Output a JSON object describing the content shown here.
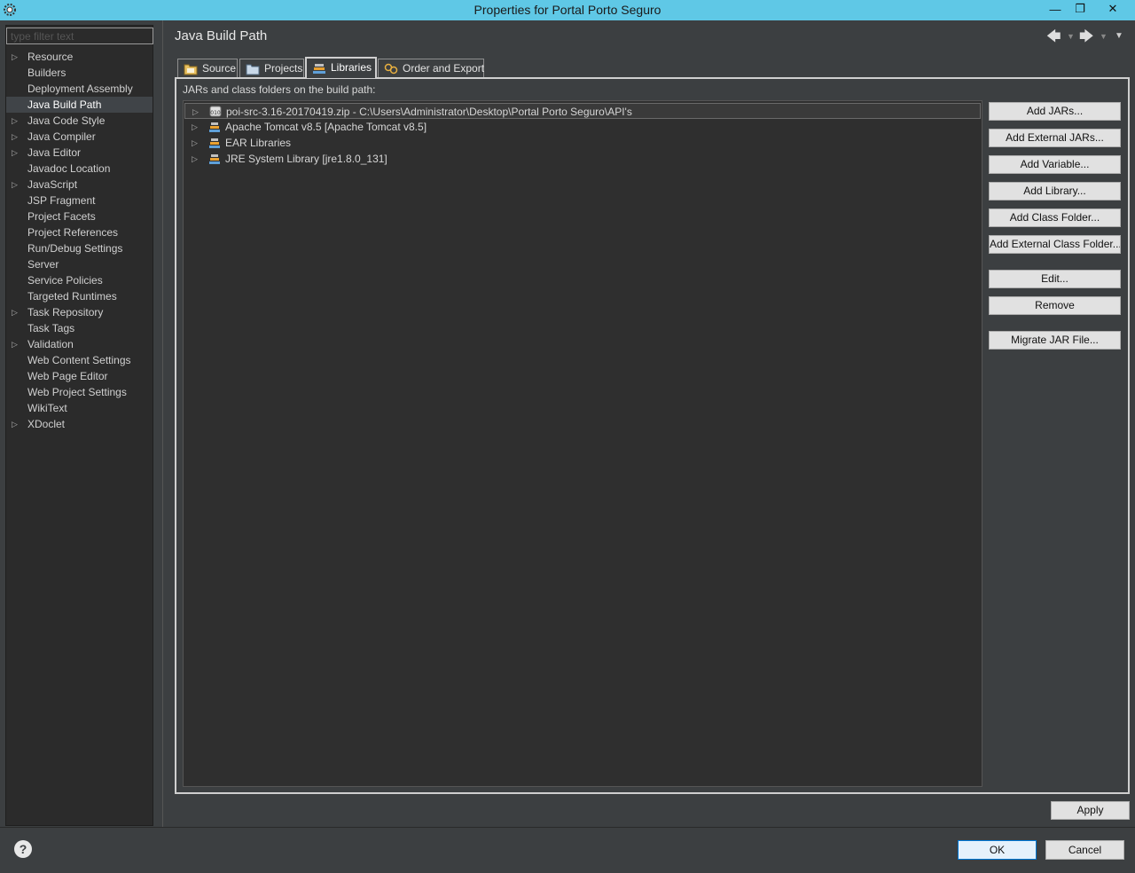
{
  "window": {
    "title": "Properties for Portal Porto Seguro",
    "minimize_glyph": "—",
    "maximize_glyph": "❐",
    "close_glyph": "✕"
  },
  "filter": {
    "placeholder": "type filter text"
  },
  "nav_tree": {
    "items": [
      {
        "label": "Resource",
        "expandable": true
      },
      {
        "label": "Builders",
        "expandable": false
      },
      {
        "label": "Deployment Assembly",
        "expandable": false
      },
      {
        "label": "Java Build Path",
        "expandable": false,
        "selected": true
      },
      {
        "label": "Java Code Style",
        "expandable": true
      },
      {
        "label": "Java Compiler",
        "expandable": true
      },
      {
        "label": "Java Editor",
        "expandable": true
      },
      {
        "label": "Javadoc Location",
        "expandable": false
      },
      {
        "label": "JavaScript",
        "expandable": true
      },
      {
        "label": "JSP Fragment",
        "expandable": false
      },
      {
        "label": "Project Facets",
        "expandable": false
      },
      {
        "label": "Project References",
        "expandable": false
      },
      {
        "label": "Run/Debug Settings",
        "expandable": false
      },
      {
        "label": "Server",
        "expandable": false
      },
      {
        "label": "Service Policies",
        "expandable": false
      },
      {
        "label": "Targeted Runtimes",
        "expandable": false
      },
      {
        "label": "Task Repository",
        "expandable": true
      },
      {
        "label": "Task Tags",
        "expandable": false
      },
      {
        "label": "Validation",
        "expandable": true
      },
      {
        "label": "Web Content Settings",
        "expandable": false
      },
      {
        "label": "Web Page Editor",
        "expandable": false
      },
      {
        "label": "Web Project Settings",
        "expandable": false
      },
      {
        "label": "WikiText",
        "expandable": false
      },
      {
        "label": "XDoclet",
        "expandable": true
      }
    ]
  },
  "page": {
    "title": "Java Build Path",
    "nav_back": "🡄",
    "nav_forward": "🡆",
    "dropdown_glyph": "▼"
  },
  "tabs": [
    {
      "label": "Source",
      "icon": "source-folder-icon"
    },
    {
      "label": "Projects",
      "icon": "project-folder-icon"
    },
    {
      "label": "Libraries",
      "icon": "library-icon",
      "active": true
    },
    {
      "label": "Order and Export",
      "icon": "order-export-icon"
    }
  ],
  "libraries": {
    "label": "JARs and class folders on the build path:",
    "items": [
      {
        "label": "poi-src-3.16-20170419.zip - C:\\Users\\Administrator\\Desktop\\Portal Porto Seguro\\API's",
        "icon": "jar-file-icon",
        "selected": true
      },
      {
        "label": "Apache Tomcat v8.5 [Apache Tomcat v8.5]",
        "icon": "library-icon"
      },
      {
        "label": "EAR Libraries",
        "icon": "library-icon"
      },
      {
        "label": "JRE System Library [jre1.8.0_131]",
        "icon": "library-icon"
      }
    ]
  },
  "buttons": {
    "add_jars": "Add JARs...",
    "add_external_jars": "Add External JARs...",
    "add_variable": "Add Variable...",
    "add_library": "Add Library...",
    "add_class_folder": "Add Class Folder...",
    "add_external_class_folder": "Add External Class Folder...",
    "edit": "Edit...",
    "remove": "Remove",
    "migrate_jar": "Migrate JAR File...",
    "apply": "Apply",
    "ok": "OK",
    "cancel": "Cancel"
  },
  "help": {
    "glyph": "?"
  }
}
